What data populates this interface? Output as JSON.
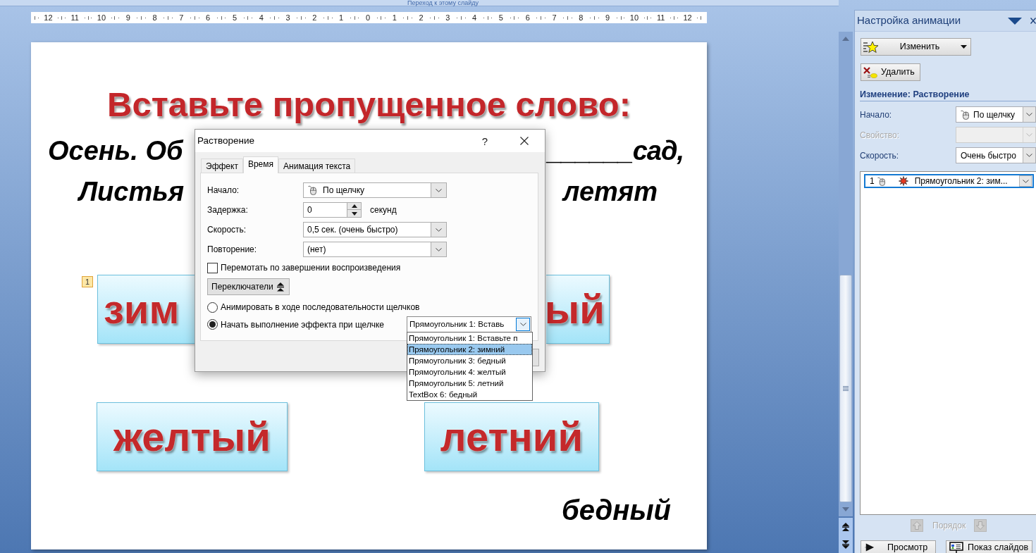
{
  "top_bar": {
    "go_to_slide": "Переход к этому слайду"
  },
  "ruler": {
    "numbers": [
      "12",
      "11",
      "10",
      "9",
      "8",
      "7",
      "6",
      "5",
      "4",
      "3",
      "2",
      "1",
      "0",
      "1",
      "2",
      "3",
      "4",
      "5",
      "6",
      "7",
      "8",
      "9",
      "10",
      "11",
      "12"
    ]
  },
  "slide": {
    "title": "Вставьте пропущенное слово:",
    "poem_fragments": [
      "Осень. Об",
      "______сад,",
      "Листья",
      "летят"
    ],
    "animation_tag": "1",
    "word_cards": [
      "зим",
      "ый",
      "желтый",
      "летний"
    ],
    "free_word": "бедный"
  },
  "dialog": {
    "title": "Растворение",
    "help": "?",
    "tabs": [
      {
        "label": "Эффект",
        "selected": false
      },
      {
        "label": "Время",
        "selected": true
      },
      {
        "label": "Анимация текста",
        "selected": false
      }
    ],
    "fields": [
      {
        "kind": "trigger",
        "label": "Начало:",
        "value": "По щелчку"
      },
      {
        "kind": "spinner",
        "label": "Задержка:",
        "value": "0",
        "unit": "секунд"
      },
      {
        "kind": "dropdown",
        "label": "Скорость:",
        "value": "0,5 сек. (очень быстро)"
      },
      {
        "kind": "dropdown",
        "label": "Повторение:",
        "value": "(нет)"
      }
    ],
    "rewind": {
      "label": "Перемотать по завершении воспроизведения",
      "checked": false
    },
    "triggers_button": "Переключатели",
    "start_options": [
      {
        "label": "Анимировать в ходе последовательности щелчков",
        "selected": false
      },
      {
        "label": "Начать выполнение эффекта при щелчке",
        "selected": true
      }
    ],
    "shape_select": {
      "value": "Прямоугольник 1: Вставь",
      "expanded": true,
      "options": [
        {
          "label": "Прямоугольник 1: Вставьте п",
          "selected": false
        },
        {
          "label": "Прямоугольник 2: зимний",
          "selected": true
        },
        {
          "label": "Прямоугольник 3: бедный",
          "selected": false
        },
        {
          "label": "Прямоугольник 4: желтый",
          "selected": false
        },
        {
          "label": "Прямоугольник 5: летний",
          "selected": false
        },
        {
          "label": "TextBox 6: бедный",
          "selected": false
        }
      ]
    }
  },
  "task_pane": {
    "title": "Настройка анимации",
    "change_button": "Изменить",
    "remove_button": "Удалить",
    "section_title": "Изменение: Растворение",
    "properties": [
      {
        "kind": "trigger",
        "label": "Начало:",
        "value": "По щелчку",
        "disabled": false
      },
      {
        "kind": "dropdown",
        "label": "Свойство:",
        "disabled": true
      },
      {
        "kind": "dropdown",
        "label": "Скорость:",
        "value": "Очень быстро",
        "disabled": false
      }
    ],
    "animation_list": [
      {
        "number": "1",
        "name": "Прямоугольник 2: зим...",
        "selected": true
      }
    ],
    "order": {
      "label": "Порядок",
      "disabled": true
    },
    "bottom_buttons": [
      {
        "kind": "play",
        "label": "Просмотр"
      },
      {
        "kind": "slideshow",
        "label": "Показ слайдов"
      }
    ]
  }
}
